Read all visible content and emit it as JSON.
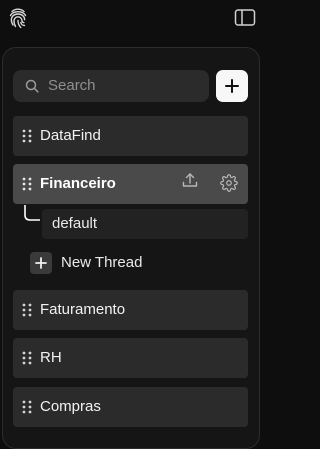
{
  "header": {
    "logo_icon": "fingerprint-icon",
    "toggle_icon": "sidebar-toggle-icon"
  },
  "search": {
    "placeholder": "Search",
    "icon": "search-icon"
  },
  "add_button": {
    "icon": "plus-icon"
  },
  "workspaces": [
    {
      "label": "DataFind",
      "active": false
    },
    {
      "label": "Financeiro",
      "active": true,
      "actions": [
        "upload-icon",
        "gear-icon"
      ]
    },
    {
      "label": "Faturamento",
      "active": false
    },
    {
      "label": "RH",
      "active": false
    },
    {
      "label": "Compras",
      "active": false
    }
  ],
  "threads": [
    {
      "label": "default"
    }
  ],
  "new_thread": {
    "label": "New Thread",
    "icon": "plus-icon"
  },
  "colors": {
    "background": "#0e0e0e",
    "panel": "#151515",
    "item": "#2b2b2b",
    "item_active": "#4a4a4a",
    "accent_button": "#f7f7f7"
  }
}
